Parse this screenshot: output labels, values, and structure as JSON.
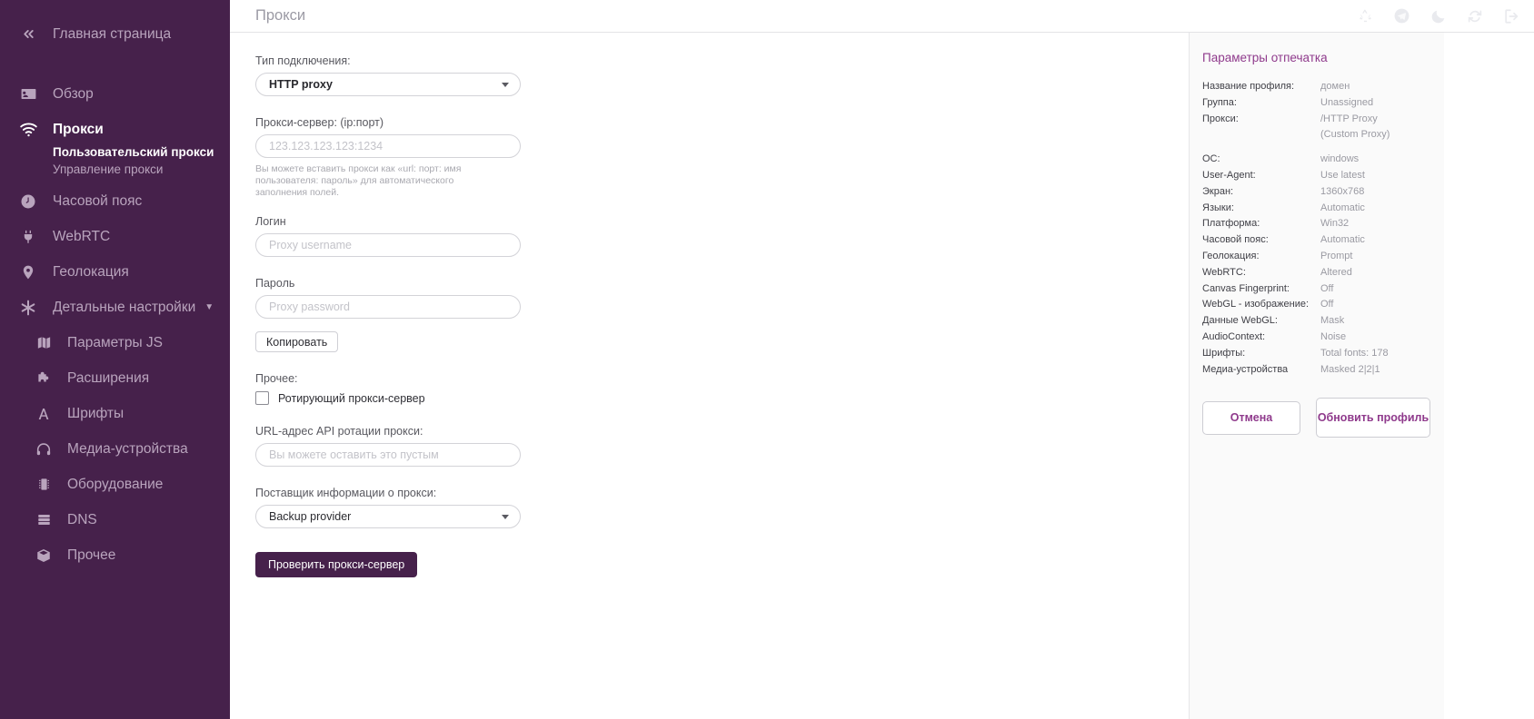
{
  "sidebar": {
    "collapse_label": "Главная страница",
    "items": [
      {
        "label": "Обзор",
        "icon": "id-card-icon",
        "active": false
      },
      {
        "label": "Прокси",
        "icon": "wifi-icon",
        "active": true
      },
      {
        "label": "Часовой пояс",
        "icon": "clock-icon",
        "active": false
      },
      {
        "label": "WebRTC",
        "icon": "plug-icon",
        "active": false
      },
      {
        "label": "Геолокация",
        "icon": "map-pin-icon",
        "active": false
      },
      {
        "label": "Детальные настройки",
        "icon": "asterisk-icon",
        "active": false,
        "expandable": true
      }
    ],
    "sub_items": [
      {
        "label": "Пользовательский прокси",
        "selected": true
      },
      {
        "label": "Управление прокси",
        "selected": false
      }
    ],
    "detail_items": [
      {
        "label": "Параметры JS",
        "icon": "map-icon"
      },
      {
        "label": "Расширения",
        "icon": "puzzle-icon"
      },
      {
        "label": "Шрифты",
        "icon": "font-icon"
      },
      {
        "label": "Медиа-устройства",
        "icon": "headphones-icon"
      },
      {
        "label": "Оборудование",
        "icon": "chip-icon"
      },
      {
        "label": "DNS",
        "icon": "server-icon"
      },
      {
        "label": "Прочее",
        "icon": "box-icon"
      }
    ]
  },
  "topbar": {
    "title": "Прокси",
    "icons": [
      "recycle-icon",
      "telegram-icon",
      "moon-icon",
      "refresh-icon",
      "logout-icon"
    ]
  },
  "form": {
    "connection_type_label": "Тип подключения:",
    "connection_type_value": "HTTP proxy",
    "proxy_server_label": "Прокси-сервер: (ip:порт)",
    "proxy_server_placeholder": "123.123.123.123:1234",
    "proxy_server_value": "",
    "hint": "Вы можете вставить прокси как «url: порт: имя пользователя: пароль» для автоматического заполнения полей.",
    "login_label": "Логин",
    "login_placeholder": "Proxy username",
    "login_value": "",
    "password_label": "Пароль",
    "password_placeholder": "Proxy password",
    "password_value": "",
    "copy_button": "Копировать",
    "other_label": "Прочее:",
    "rotating_checkbox_label": "Ротирующий прокси-сервер",
    "rotating_checked": false,
    "rotation_url_label": "URL-адрес API ротации прокси:",
    "rotation_url_placeholder": "Вы можете оставить это пустым",
    "rotation_url_value": "",
    "provider_label": "Поставщик информации о прокси:",
    "provider_value": "Backup provider",
    "check_button": "Проверить прокси-сервер"
  },
  "fingerprint": {
    "title": "Параметры отпечатка",
    "rows": [
      {
        "key": "Название профиля:",
        "value": "домен"
      },
      {
        "key": "Группа:",
        "value": "Unassigned"
      },
      {
        "key": "Прокси:",
        "value": "/HTTP Proxy\n(Custom Proxy)"
      },
      {
        "key": "ОС:",
        "value": "windows"
      },
      {
        "key": "User-Agent:",
        "value": "Use latest"
      },
      {
        "key": "Экран:",
        "value": "1360x768"
      },
      {
        "key": "Языки:",
        "value": "Automatic"
      },
      {
        "key": "Платформа:",
        "value": "Win32"
      },
      {
        "key": "Часовой пояс:",
        "value": "Automatic"
      },
      {
        "key": "Геолокация:",
        "value": "Prompt"
      },
      {
        "key": "WebRTC:",
        "value": "Altered"
      },
      {
        "key": "Canvas Fingerprint:",
        "value": "Off"
      },
      {
        "key": "WebGL - изображение:",
        "value": "Off"
      },
      {
        "key": "Данные WebGL:",
        "value": "Mask"
      },
      {
        "key": "AudioContext:",
        "value": "Noise"
      },
      {
        "key": "Шрифты:",
        "value": "Total fonts: 178"
      },
      {
        "key": "Медиа-устройства",
        "value": "Masked 2|2|1"
      }
    ],
    "cancel_button": "Отмена",
    "update_button": "Обновить профиль"
  },
  "colors": {
    "sidebar_bg": "#46214b",
    "accent": "#8f3a8c",
    "primary_button": "#46214b"
  }
}
